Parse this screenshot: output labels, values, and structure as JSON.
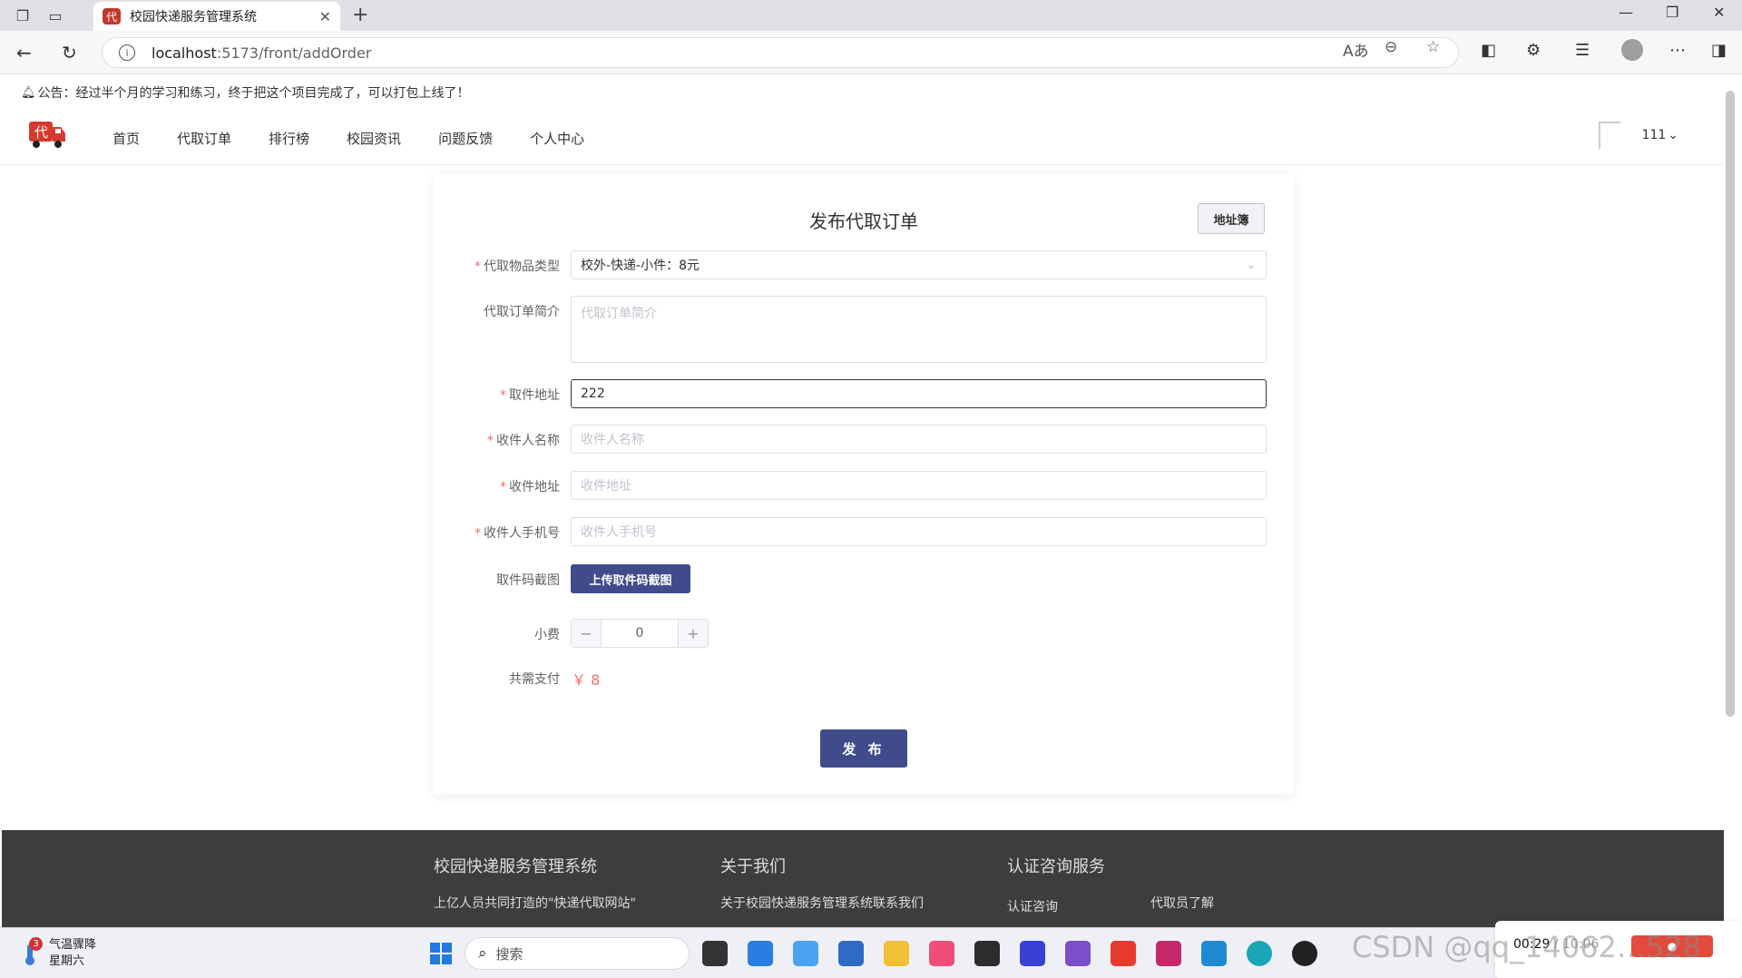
{
  "browser": {
    "tab_title": "校园快递服务管理系统",
    "url_host": "localhost",
    "url_path": ":5173/front/addOrder",
    "translate_icon": "Aあ"
  },
  "notice": {
    "text": "公告：经过半个月的学习和练习，终于把这个项目完成了，可以打包上线了！"
  },
  "logo": {
    "char": "代"
  },
  "nav": {
    "items": [
      {
        "label": "首页"
      },
      {
        "label": "代取订单"
      },
      {
        "label": "排行榜"
      },
      {
        "label": "校园资讯"
      },
      {
        "label": "问题反馈"
      },
      {
        "label": "个人中心"
      }
    ]
  },
  "user": {
    "name": "111"
  },
  "form": {
    "title": "发布代取订单",
    "address_book_button": "地址簿",
    "item_type": {
      "label": "代取物品类型",
      "value": "校外-快递-小件：8元"
    },
    "intro": {
      "label": "代取订单简介",
      "placeholder": "代取订单简介"
    },
    "pickup_address": {
      "label": "取件地址",
      "value": "222"
    },
    "receiver_name": {
      "label": "收件人名称",
      "placeholder": "收件人名称"
    },
    "receiver_address": {
      "label": "收件地址",
      "placeholder": "收件地址"
    },
    "receiver_phone": {
      "label": "收件人手机号",
      "placeholder": "收件人手机号"
    },
    "code_screenshot": {
      "label": "取件码截图",
      "button": "上传取件码截图"
    },
    "tip": {
      "label": "小费",
      "value": "0",
      "minus": "−",
      "plus": "+"
    },
    "total": {
      "label": "共需支付",
      "value": "￥ 8"
    },
    "submit_button": "发 布"
  },
  "footer": {
    "col1": {
      "title": "校园快递服务管理系统",
      "text": "上亿人员共同打造的\"快递代取网站\""
    },
    "col2": {
      "title": "关于我们",
      "text": "关于校园快递服务管理系统联系我们"
    },
    "col3": {
      "title": "认证咨询服务",
      "link1": "认证咨询",
      "link2": "代取员了解"
    }
  },
  "taskbar": {
    "weather_badge": "3",
    "weather_title": "气温骤降",
    "weather_day": "星期六",
    "search_label": "搜索",
    "time": "00:29",
    "time_extra": "/ 10:06"
  },
  "watermark": "CSDN @qq_14062…528"
}
